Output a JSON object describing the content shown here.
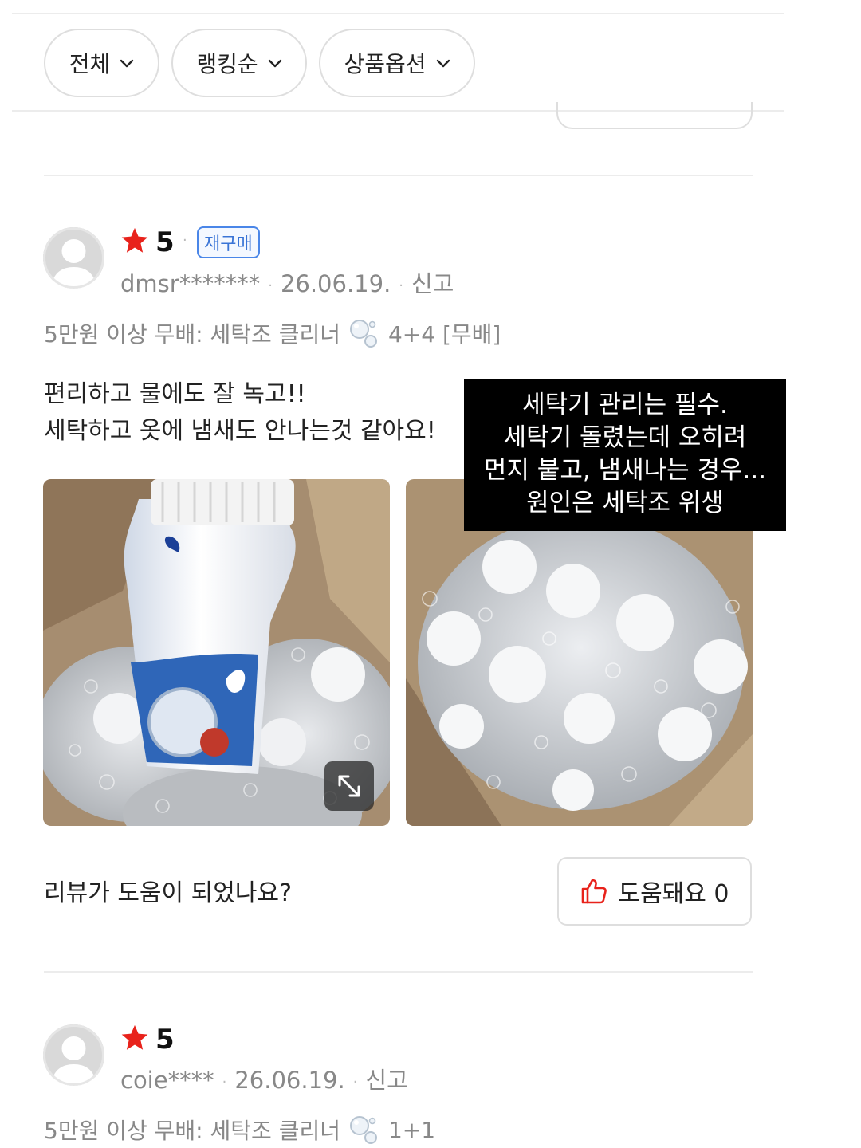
{
  "filters": {
    "all": "전체",
    "ranking": "랭킹순",
    "product_option": "상품옵션"
  },
  "reviews": [
    {
      "rating": "5",
      "badge": "재구매",
      "user": "dmsr*******",
      "date": "26.06.19.",
      "report": "신고",
      "option_prefix": "5만원 이상 무배: 세탁조 클리너",
      "option_suffix": "4+4 [무배]",
      "text_line1": "편리하고 물에도 잘 녹고!!",
      "text_line2": "세탁하고 옷에 냄새도 안나는것 같아요!",
      "photo_caption": [
        "세탁기 관리는 필수.",
        "세탁기 돌렸는데 오히려",
        "먼지 붙고, 냄새나는 경우...",
        "원인은 세탁조 위생"
      ],
      "helpful_question": "리뷰가 도움이 되었나요?",
      "helpful_label": "도움돼요 0"
    },
    {
      "rating": "5",
      "user": "coie****",
      "date": "26.06.19.",
      "report": "신고",
      "option_prefix": "5만원 이상 무배: 세탁조 클리너",
      "option_suffix": "1+1"
    }
  ],
  "colors": {
    "star": "#e8221b",
    "badge_blue": "#3a74d6",
    "muted_text": "#888888",
    "divider": "#ececec"
  },
  "icons": [
    "chevron-down-icon",
    "star-icon",
    "avatar-placeholder-icon",
    "bubbles-icon",
    "expand-icon",
    "thumbs-up-icon"
  ]
}
